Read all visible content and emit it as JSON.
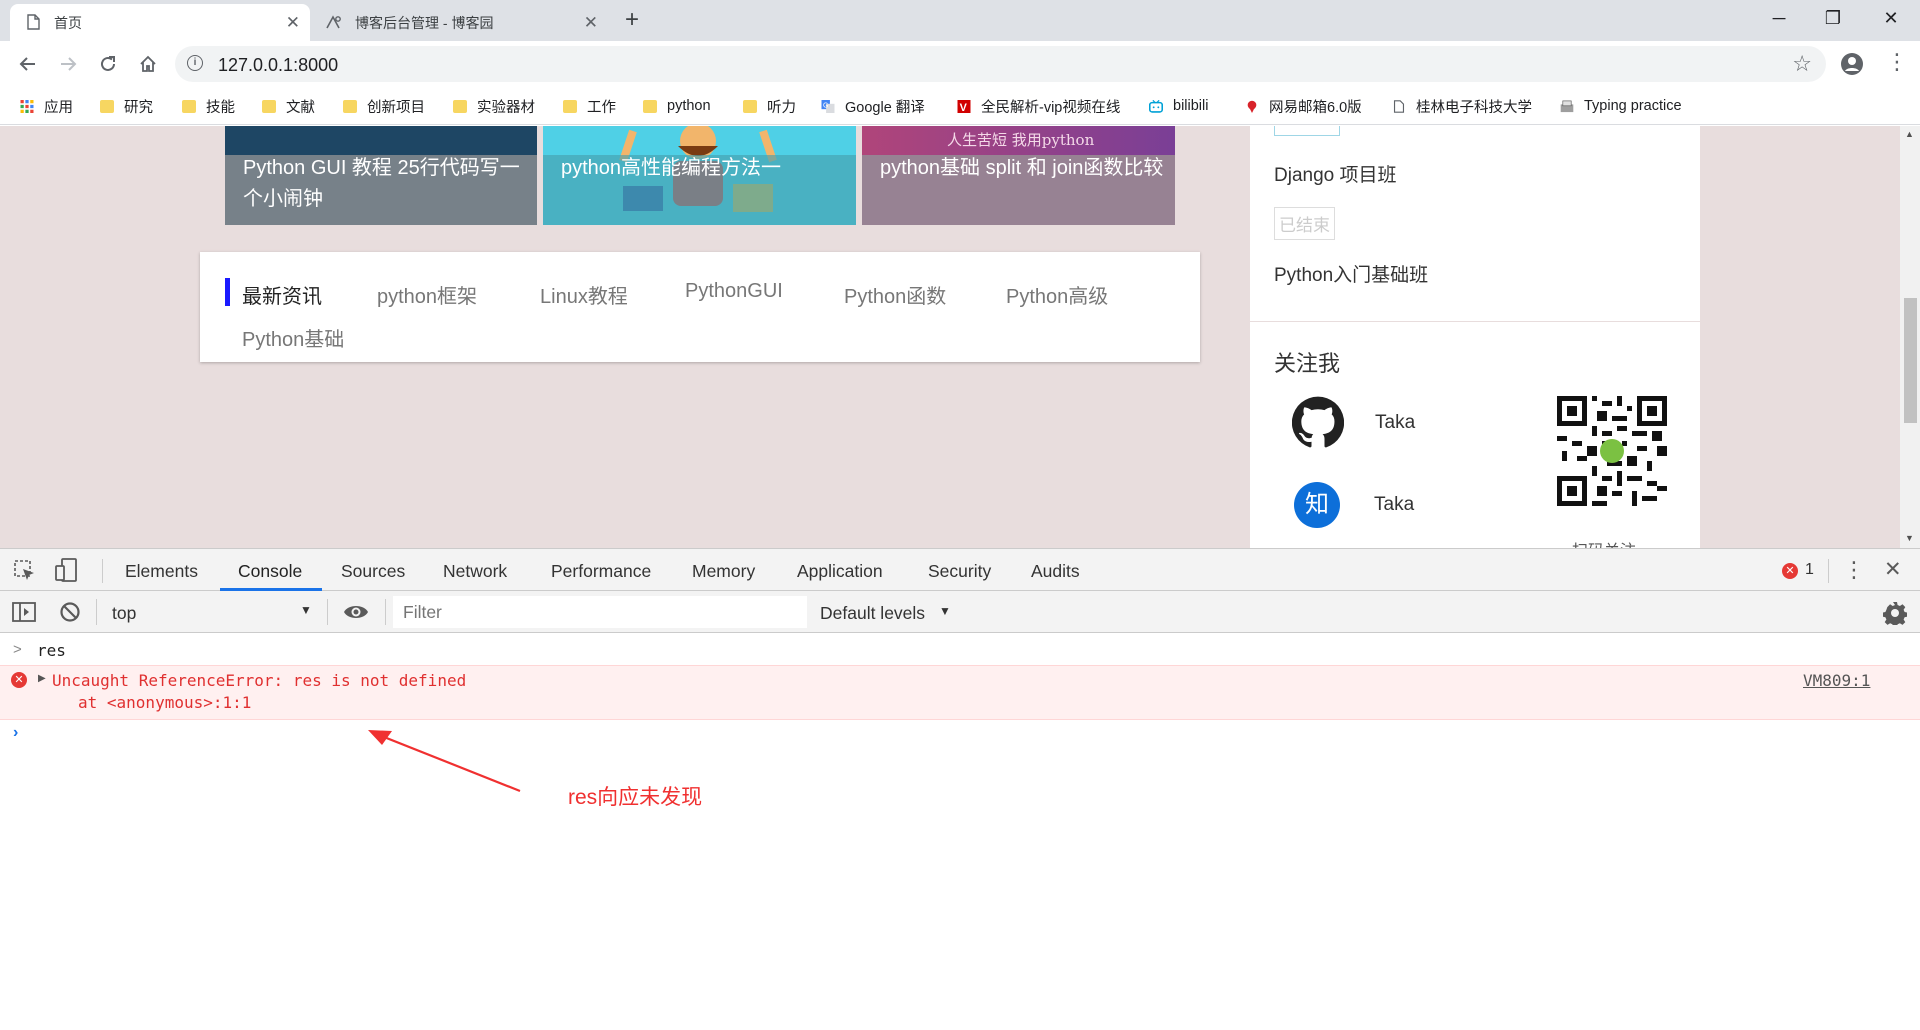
{
  "tabs": [
    {
      "title": "首页",
      "active": true
    },
    {
      "title": "博客后台管理 - 博客园",
      "active": false
    }
  ],
  "new_tab_label": "+",
  "window_controls": {
    "minimize": "─",
    "restore": "❐",
    "close": "✕"
  },
  "toolbar": {
    "url": "127.0.0.1:8000"
  },
  "bookmarks": [
    {
      "label": "应用",
      "icon": "apps-grid-icon"
    },
    {
      "label": "研究",
      "icon": "folder-icon"
    },
    {
      "label": "技能",
      "icon": "folder-icon"
    },
    {
      "label": "文献",
      "icon": "folder-icon"
    },
    {
      "label": "创新项目",
      "icon": "folder-icon"
    },
    {
      "label": "实验器材",
      "icon": "folder-icon"
    },
    {
      "label": "工作",
      "icon": "folder-icon"
    },
    {
      "label": "python",
      "icon": "folder-icon"
    },
    {
      "label": "听力",
      "icon": "folder-icon"
    },
    {
      "label": "Google 翻译",
      "icon": "google-translate-icon"
    },
    {
      "label": "全民解析-vip视频在线",
      "icon": "v-logo-icon"
    },
    {
      "label": "bilibili",
      "icon": "bilibili-icon"
    },
    {
      "label": "网易邮箱6.0版",
      "icon": "netease-mail-icon"
    },
    {
      "label": "桂林电子科技大学",
      "icon": "page-icon"
    },
    {
      "label": "Typing practice",
      "icon": "typing-icon"
    }
  ],
  "page": {
    "articles": [
      {
        "caption": "Python GUI 教程 25行代码写一个小闹钟"
      },
      {
        "caption": "python高性能编程方法一"
      },
      {
        "caption": "python基础 split 和 join函数比较",
        "banner": "人生苦短 我用python"
      }
    ],
    "categories": [
      "最新资讯",
      "python框架",
      "Linux教程",
      "PythonGUI",
      "Python函数",
      "Python高级",
      "Python基础"
    ],
    "sidebar": {
      "courses": [
        {
          "name": "Django 项目班"
        },
        {
          "status": "已结束",
          "name": "Python入门基础班"
        }
      ],
      "follow_title": "关注我",
      "follow": [
        {
          "icon": "github-icon",
          "name": "Taka"
        },
        {
          "icon": "zhihu-icon",
          "glyph": "知",
          "name": "Taka"
        }
      ],
      "qr_caption": "扫码关注"
    }
  },
  "devtools": {
    "tabs": [
      "Elements",
      "Console",
      "Sources",
      "Network",
      "Performance",
      "Memory",
      "Application",
      "Security",
      "Audits"
    ],
    "active_tab": "Console",
    "error_count": "1",
    "context": "top",
    "filter_placeholder": "Filter",
    "levels": "Default levels",
    "console": {
      "input": "res",
      "error_line1": "Uncaught ReferenceError: res is not defined",
      "error_line2": "at <anonymous>:1:1",
      "source": "VM809:1"
    }
  },
  "annotation": {
    "text": "res向应未发现",
    "color": "#f03030"
  }
}
